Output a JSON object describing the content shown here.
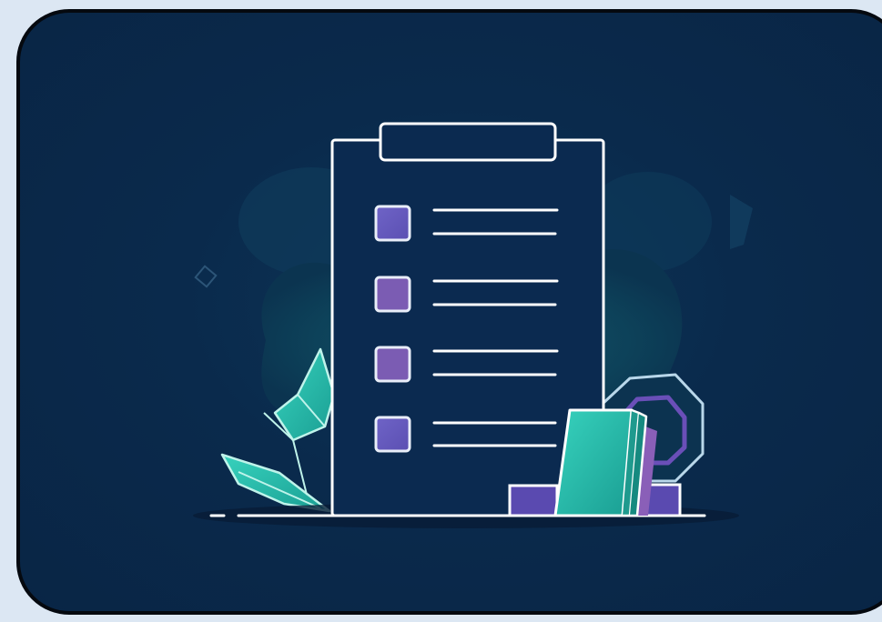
{
  "illustration": {
    "subject": "clipboard-checklist",
    "checklist_item_count": 4,
    "colors": {
      "background": "#0a2a4c",
      "frame_border": "#05090f",
      "page_background": "#dce7f3",
      "outline": "#ffffff",
      "checkbox_fill": "#6a5bb8",
      "teal_accent": "#27b8a6",
      "purple_accent": "#7a5cb0",
      "blob": "#0f4a5f"
    }
  }
}
